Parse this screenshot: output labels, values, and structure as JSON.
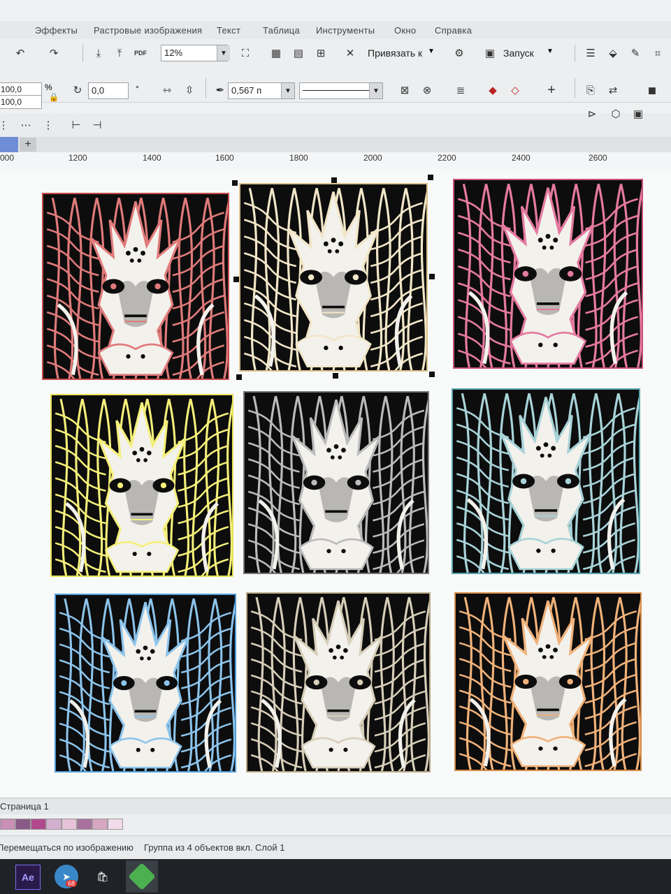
{
  "menu": {
    "items": [
      "Эффекты",
      "Растровые изображения",
      "Текст",
      "Таблица",
      "Инструменты",
      "Окно",
      "Справка"
    ]
  },
  "toolbar": {
    "zoom_value": "12%",
    "snap_label": "Привязать к",
    "launch_label": "Запуск",
    "pdf_label": "PDF"
  },
  "propbar": {
    "width_value": "100,0",
    "height_value": "100,0",
    "percent_label": "%",
    "rotation_value": "0,0",
    "outline_value": "0,567 п",
    "rotation_unit": "°"
  },
  "ruler": {
    "ticks": [
      "000",
      "1200",
      "1400",
      "1600",
      "1800",
      "2000",
      "2200",
      "2400",
      "2600"
    ]
  },
  "canvas": {
    "tiles": [
      {
        "outline": "#c84a4a",
        "line": "#e07a7a"
      },
      {
        "outline": "#d9c38a",
        "line": "#f2e6c8",
        "selected": true
      },
      {
        "outline": "#c8507a",
        "line": "#e57aa0"
      },
      {
        "outline": "#e6e255",
        "line": "#f5f07a"
      },
      {
        "outline": "#777777",
        "line": "#bbbbbb"
      },
      {
        "outline": "#5aa4ad",
        "line": "#a8d3d8"
      },
      {
        "outline": "#4f9bd6",
        "line": "#8cc4ec"
      },
      {
        "outline": "#b8a887",
        "line": "#d8cfba"
      },
      {
        "outline": "#d88d48",
        "line": "#f0b27a"
      }
    ]
  },
  "pages": {
    "label": "Страница 1"
  },
  "palette": {
    "colors": [
      "#c98fb6",
      "#8a5a86",
      "#b04a8d",
      "#d4b0cf",
      "#e6c3d8",
      "#a8729c",
      "#d6a6c2",
      "#f1dbe8"
    ]
  },
  "status": {
    "hint": "Перемещаться по изображению",
    "selection": "Группа из 4 объектов вкл. Слой 1"
  },
  "taskbar": {
    "ae_label": "Ae",
    "badge_count": "68"
  }
}
